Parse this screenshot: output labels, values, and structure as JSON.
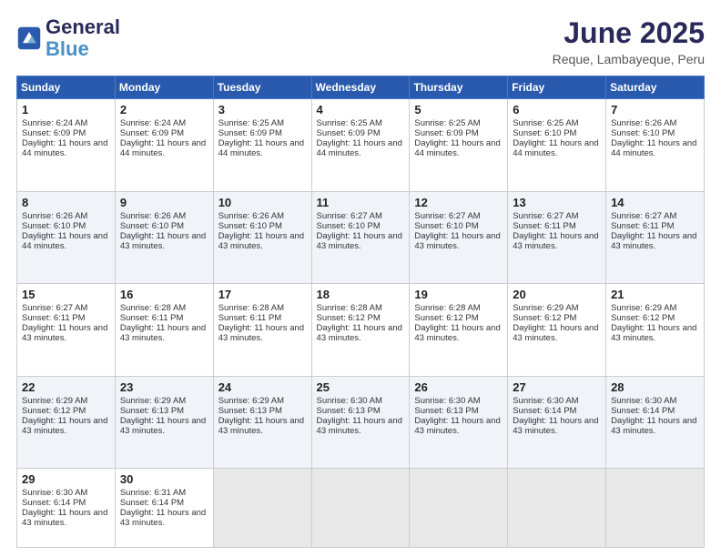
{
  "header": {
    "logo_line1": "General",
    "logo_line2": "Blue",
    "month": "June 2025",
    "location": "Reque, Lambayeque, Peru"
  },
  "days_of_week": [
    "Sunday",
    "Monday",
    "Tuesday",
    "Wednesday",
    "Thursday",
    "Friday",
    "Saturday"
  ],
  "weeks": [
    [
      {
        "day": "1",
        "sunrise": "6:24 AM",
        "sunset": "6:09 PM",
        "daylight": "11 hours and 44 minutes."
      },
      {
        "day": "2",
        "sunrise": "6:24 AM",
        "sunset": "6:09 PM",
        "daylight": "11 hours and 44 minutes."
      },
      {
        "day": "3",
        "sunrise": "6:25 AM",
        "sunset": "6:09 PM",
        "daylight": "11 hours and 44 minutes."
      },
      {
        "day": "4",
        "sunrise": "6:25 AM",
        "sunset": "6:09 PM",
        "daylight": "11 hours and 44 minutes."
      },
      {
        "day": "5",
        "sunrise": "6:25 AM",
        "sunset": "6:09 PM",
        "daylight": "11 hours and 44 minutes."
      },
      {
        "day": "6",
        "sunrise": "6:25 AM",
        "sunset": "6:10 PM",
        "daylight": "11 hours and 44 minutes."
      },
      {
        "day": "7",
        "sunrise": "6:26 AM",
        "sunset": "6:10 PM",
        "daylight": "11 hours and 44 minutes."
      }
    ],
    [
      {
        "day": "8",
        "sunrise": "6:26 AM",
        "sunset": "6:10 PM",
        "daylight": "11 hours and 44 minutes."
      },
      {
        "day": "9",
        "sunrise": "6:26 AM",
        "sunset": "6:10 PM",
        "daylight": "11 hours and 43 minutes."
      },
      {
        "day": "10",
        "sunrise": "6:26 AM",
        "sunset": "6:10 PM",
        "daylight": "11 hours and 43 minutes."
      },
      {
        "day": "11",
        "sunrise": "6:27 AM",
        "sunset": "6:10 PM",
        "daylight": "11 hours and 43 minutes."
      },
      {
        "day": "12",
        "sunrise": "6:27 AM",
        "sunset": "6:10 PM",
        "daylight": "11 hours and 43 minutes."
      },
      {
        "day": "13",
        "sunrise": "6:27 AM",
        "sunset": "6:11 PM",
        "daylight": "11 hours and 43 minutes."
      },
      {
        "day": "14",
        "sunrise": "6:27 AM",
        "sunset": "6:11 PM",
        "daylight": "11 hours and 43 minutes."
      }
    ],
    [
      {
        "day": "15",
        "sunrise": "6:27 AM",
        "sunset": "6:11 PM",
        "daylight": "11 hours and 43 minutes."
      },
      {
        "day": "16",
        "sunrise": "6:28 AM",
        "sunset": "6:11 PM",
        "daylight": "11 hours and 43 minutes."
      },
      {
        "day": "17",
        "sunrise": "6:28 AM",
        "sunset": "6:11 PM",
        "daylight": "11 hours and 43 minutes."
      },
      {
        "day": "18",
        "sunrise": "6:28 AM",
        "sunset": "6:12 PM",
        "daylight": "11 hours and 43 minutes."
      },
      {
        "day": "19",
        "sunrise": "6:28 AM",
        "sunset": "6:12 PM",
        "daylight": "11 hours and 43 minutes."
      },
      {
        "day": "20",
        "sunrise": "6:29 AM",
        "sunset": "6:12 PM",
        "daylight": "11 hours and 43 minutes."
      },
      {
        "day": "21",
        "sunrise": "6:29 AM",
        "sunset": "6:12 PM",
        "daylight": "11 hours and 43 minutes."
      }
    ],
    [
      {
        "day": "22",
        "sunrise": "6:29 AM",
        "sunset": "6:12 PM",
        "daylight": "11 hours and 43 minutes."
      },
      {
        "day": "23",
        "sunrise": "6:29 AM",
        "sunset": "6:13 PM",
        "daylight": "11 hours and 43 minutes."
      },
      {
        "day": "24",
        "sunrise": "6:29 AM",
        "sunset": "6:13 PM",
        "daylight": "11 hours and 43 minutes."
      },
      {
        "day": "25",
        "sunrise": "6:30 AM",
        "sunset": "6:13 PM",
        "daylight": "11 hours and 43 minutes."
      },
      {
        "day": "26",
        "sunrise": "6:30 AM",
        "sunset": "6:13 PM",
        "daylight": "11 hours and 43 minutes."
      },
      {
        "day": "27",
        "sunrise": "6:30 AM",
        "sunset": "6:14 PM",
        "daylight": "11 hours and 43 minutes."
      },
      {
        "day": "28",
        "sunrise": "6:30 AM",
        "sunset": "6:14 PM",
        "daylight": "11 hours and 43 minutes."
      }
    ],
    [
      {
        "day": "29",
        "sunrise": "6:30 AM",
        "sunset": "6:14 PM",
        "daylight": "11 hours and 43 minutes."
      },
      {
        "day": "30",
        "sunrise": "6:31 AM",
        "sunset": "6:14 PM",
        "daylight": "11 hours and 43 minutes."
      },
      null,
      null,
      null,
      null,
      null
    ]
  ]
}
